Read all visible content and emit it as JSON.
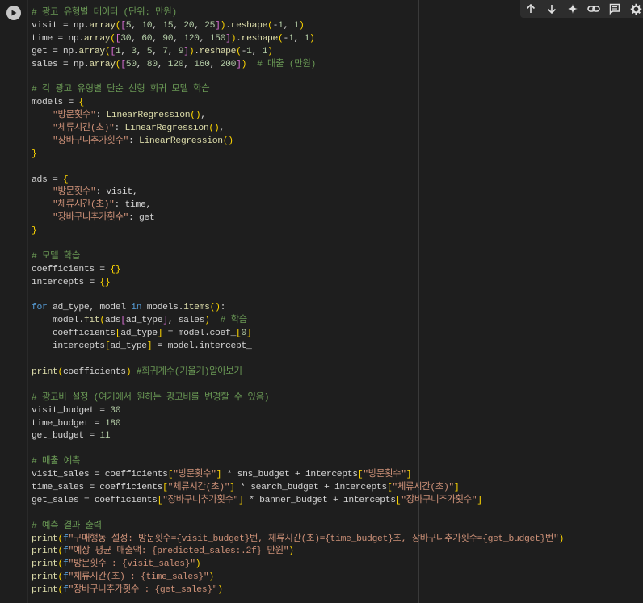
{
  "toolbar": {
    "buttons": [
      {
        "name": "move-up-icon"
      },
      {
        "name": "move-down-icon"
      },
      {
        "name": "sparkle-icon"
      },
      {
        "name": "link-icon"
      },
      {
        "name": "comment-icon"
      },
      {
        "name": "settings-icon"
      }
    ]
  },
  "cell": {
    "run_icon": "play-icon",
    "lines": [
      "# 광고 유형별 데이터 (단위: 만원)",
      "visit = np.array([5, 10, 15, 20, 25]).reshape(-1, 1)",
      "time = np.array([30, 60, 90, 120, 150]).reshape(-1, 1)",
      "get = np.array([1, 3, 5, 7, 9]).reshape(-1, 1)",
      "sales = np.array([50, 80, 120, 160, 200])  # 매출 (만원)",
      "",
      "# 각 광고 유형별 단순 선형 회귀 모델 학습",
      "models = {",
      "    \"방문횟수\": LinearRegression(),",
      "    \"체류시간(초)\": LinearRegression(),",
      "    \"장바구니추가횟수\": LinearRegression()",
      "}",
      "",
      "ads = {",
      "    \"방문횟수\": visit,",
      "    \"체류시간(초)\": time,",
      "    \"장바구니추가횟수\": get",
      "}",
      "",
      "# 모델 학습",
      "coefficients = {}",
      "intercepts = {}",
      "",
      "for ad_type, model in models.items():",
      "    model.fit(ads[ad_type], sales)  # 학습",
      "    coefficients[ad_type] = model.coef_[0]",
      "    intercepts[ad_type] = model.intercept_",
      "",
      "print(coefficients) #회귀계수(기울기)알아보기",
      "",
      "# 광고비 설정 (여기에서 원하는 광고비를 변경할 수 있음)",
      "visit_budget = 30",
      "time_budget = 180",
      "get_budget = 11",
      "",
      "# 매출 예측",
      "visit_sales = coefficients[\"방문횟수\"] * sns_budget + intercepts[\"방문횟수\"]",
      "time_sales = coefficients[\"체류시간(초)\"] * search_budget + intercepts[\"체류시간(초)\"]",
      "get_sales = coefficients[\"장바구니추가횟수\"] * banner_budget + intercepts[\"장바구니추가횟수\"]",
      "",
      "# 예측 결과 출력",
      "print(f\"구매행동 설정: 방문횟수={visit_budget}번, 체류시간(초)={time_budget}초, 장바구니추가횟수={get_budget}번\")",
      "print(f\"예상 평균 매출액: {predicted_sales:.2f} 만원\")",
      "print(f\"방문횟수 : {visit_sales}\")",
      "print(f\"체류시간(초) : {time_sales}\")",
      "print(f\"장바구니추가횟수 : {get_sales}\")"
    ]
  },
  "colors": {
    "background": "#1e1e1e",
    "keyword": "#569cd6",
    "string": "#ce9178",
    "comment": "#6a9955",
    "number": "#b5cea8",
    "function": "#dcdcaa",
    "bracket1": "#ffd700",
    "bracket2": "#da70d6",
    "bracket3": "#179fff"
  }
}
